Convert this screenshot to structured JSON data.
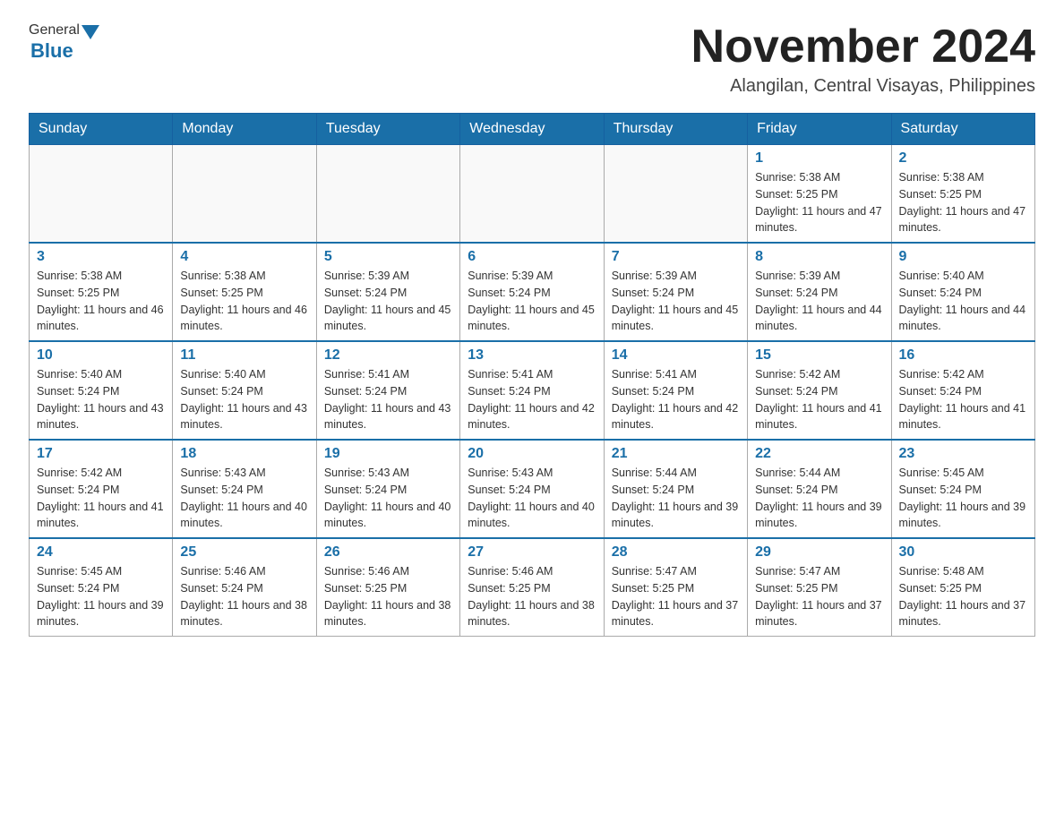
{
  "header": {
    "logo_general": "General",
    "logo_blue": "Blue",
    "month_title": "November 2024",
    "location": "Alangilan, Central Visayas, Philippines"
  },
  "days_of_week": [
    "Sunday",
    "Monday",
    "Tuesday",
    "Wednesday",
    "Thursday",
    "Friday",
    "Saturday"
  ],
  "weeks": [
    [
      {
        "day": "",
        "info": ""
      },
      {
        "day": "",
        "info": ""
      },
      {
        "day": "",
        "info": ""
      },
      {
        "day": "",
        "info": ""
      },
      {
        "day": "",
        "info": ""
      },
      {
        "day": "1",
        "info": "Sunrise: 5:38 AM\nSunset: 5:25 PM\nDaylight: 11 hours and 47 minutes."
      },
      {
        "day": "2",
        "info": "Sunrise: 5:38 AM\nSunset: 5:25 PM\nDaylight: 11 hours and 47 minutes."
      }
    ],
    [
      {
        "day": "3",
        "info": "Sunrise: 5:38 AM\nSunset: 5:25 PM\nDaylight: 11 hours and 46 minutes."
      },
      {
        "day": "4",
        "info": "Sunrise: 5:38 AM\nSunset: 5:25 PM\nDaylight: 11 hours and 46 minutes."
      },
      {
        "day": "5",
        "info": "Sunrise: 5:39 AM\nSunset: 5:24 PM\nDaylight: 11 hours and 45 minutes."
      },
      {
        "day": "6",
        "info": "Sunrise: 5:39 AM\nSunset: 5:24 PM\nDaylight: 11 hours and 45 minutes."
      },
      {
        "day": "7",
        "info": "Sunrise: 5:39 AM\nSunset: 5:24 PM\nDaylight: 11 hours and 45 minutes."
      },
      {
        "day": "8",
        "info": "Sunrise: 5:39 AM\nSunset: 5:24 PM\nDaylight: 11 hours and 44 minutes."
      },
      {
        "day": "9",
        "info": "Sunrise: 5:40 AM\nSunset: 5:24 PM\nDaylight: 11 hours and 44 minutes."
      }
    ],
    [
      {
        "day": "10",
        "info": "Sunrise: 5:40 AM\nSunset: 5:24 PM\nDaylight: 11 hours and 43 minutes."
      },
      {
        "day": "11",
        "info": "Sunrise: 5:40 AM\nSunset: 5:24 PM\nDaylight: 11 hours and 43 minutes."
      },
      {
        "day": "12",
        "info": "Sunrise: 5:41 AM\nSunset: 5:24 PM\nDaylight: 11 hours and 43 minutes."
      },
      {
        "day": "13",
        "info": "Sunrise: 5:41 AM\nSunset: 5:24 PM\nDaylight: 11 hours and 42 minutes."
      },
      {
        "day": "14",
        "info": "Sunrise: 5:41 AM\nSunset: 5:24 PM\nDaylight: 11 hours and 42 minutes."
      },
      {
        "day": "15",
        "info": "Sunrise: 5:42 AM\nSunset: 5:24 PM\nDaylight: 11 hours and 41 minutes."
      },
      {
        "day": "16",
        "info": "Sunrise: 5:42 AM\nSunset: 5:24 PM\nDaylight: 11 hours and 41 minutes."
      }
    ],
    [
      {
        "day": "17",
        "info": "Sunrise: 5:42 AM\nSunset: 5:24 PM\nDaylight: 11 hours and 41 minutes."
      },
      {
        "day": "18",
        "info": "Sunrise: 5:43 AM\nSunset: 5:24 PM\nDaylight: 11 hours and 40 minutes."
      },
      {
        "day": "19",
        "info": "Sunrise: 5:43 AM\nSunset: 5:24 PM\nDaylight: 11 hours and 40 minutes."
      },
      {
        "day": "20",
        "info": "Sunrise: 5:43 AM\nSunset: 5:24 PM\nDaylight: 11 hours and 40 minutes."
      },
      {
        "day": "21",
        "info": "Sunrise: 5:44 AM\nSunset: 5:24 PM\nDaylight: 11 hours and 39 minutes."
      },
      {
        "day": "22",
        "info": "Sunrise: 5:44 AM\nSunset: 5:24 PM\nDaylight: 11 hours and 39 minutes."
      },
      {
        "day": "23",
        "info": "Sunrise: 5:45 AM\nSunset: 5:24 PM\nDaylight: 11 hours and 39 minutes."
      }
    ],
    [
      {
        "day": "24",
        "info": "Sunrise: 5:45 AM\nSunset: 5:24 PM\nDaylight: 11 hours and 39 minutes."
      },
      {
        "day": "25",
        "info": "Sunrise: 5:46 AM\nSunset: 5:24 PM\nDaylight: 11 hours and 38 minutes."
      },
      {
        "day": "26",
        "info": "Sunrise: 5:46 AM\nSunset: 5:25 PM\nDaylight: 11 hours and 38 minutes."
      },
      {
        "day": "27",
        "info": "Sunrise: 5:46 AM\nSunset: 5:25 PM\nDaylight: 11 hours and 38 minutes."
      },
      {
        "day": "28",
        "info": "Sunrise: 5:47 AM\nSunset: 5:25 PM\nDaylight: 11 hours and 37 minutes."
      },
      {
        "day": "29",
        "info": "Sunrise: 5:47 AM\nSunset: 5:25 PM\nDaylight: 11 hours and 37 minutes."
      },
      {
        "day": "30",
        "info": "Sunrise: 5:48 AM\nSunset: 5:25 PM\nDaylight: 11 hours and 37 minutes."
      }
    ]
  ]
}
